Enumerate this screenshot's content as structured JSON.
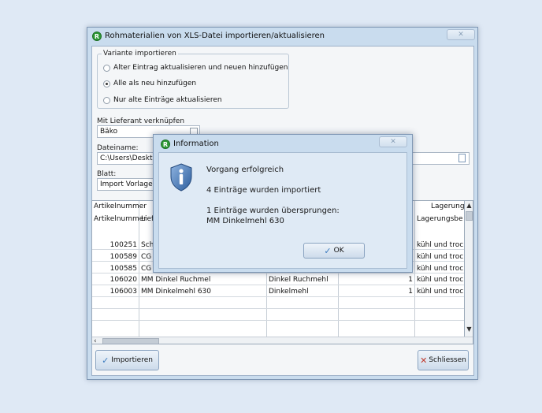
{
  "main_window": {
    "title": "Rohmaterialien von XLS-Datei importieren/aktualisieren",
    "app_icon_letter": "R",
    "close_glyph": "✕"
  },
  "variant_group": {
    "legend": "Variante importieren",
    "options": [
      {
        "label": "Alter Eintrag aktualisieren und neuen hinzufügen",
        "selected": false
      },
      {
        "label": "Alle als neu hinzufügen",
        "selected": true
      },
      {
        "label": "Nur alte Einträge aktualisieren",
        "selected": false
      }
    ]
  },
  "supplier": {
    "label": "Mit Lieferant verknüpfen",
    "value": "Bäko"
  },
  "filename": {
    "label": "Dateiname:",
    "value": "C:\\Users\\Desktop"
  },
  "sheet": {
    "label": "Blatt:",
    "value": "Import Vorlage"
  },
  "grid": {
    "header_row1": {
      "col1": "Artikelnummer",
      "col_last": "Lagerung"
    },
    "header_row2": {
      "col1": "Artikelnummer",
      "col2": "Liefe",
      "col_last": "Lagerungsbedi"
    },
    "rows": [
      {
        "nr": "100251",
        "name": "Sch",
        "desc": "",
        "qty": "",
        "storage": "kühl und trocke"
      },
      {
        "nr": "100589",
        "name": "CG C",
        "desc": "",
        "qty": "",
        "storage": "kühl und trocke"
      },
      {
        "nr": "100585",
        "name": "CG C",
        "desc": "",
        "qty": "",
        "storage": "kühl und trocke"
      },
      {
        "nr": "106020",
        "name": "MM Dinkel Ruchmel",
        "desc": "Dinkel Ruchmehl",
        "qty": "1",
        "storage": "kühl und trocke"
      },
      {
        "nr": "106003",
        "name": "MM Dinkelmehl 630",
        "desc": "Dinkelmehl",
        "qty": "1",
        "storage": "kühl und trocke"
      }
    ]
  },
  "buttons": {
    "import": "Importieren",
    "close": "Schliessen"
  },
  "dialog": {
    "title": "Information",
    "app_icon_letter": "R",
    "close_glyph": "✕",
    "line1": "Vorgang erfolgreich",
    "line2": "4 Einträge wurden importiert",
    "line3": "1 Einträge wurden übersprungen:",
    "line4": "MM Dinkelmehl 630",
    "ok_label": "OK"
  },
  "colors": {
    "accent": "#2f9a37",
    "window_frame": "#c9dcee",
    "check": "#3b7bbf",
    "cross": "#c0392b"
  }
}
